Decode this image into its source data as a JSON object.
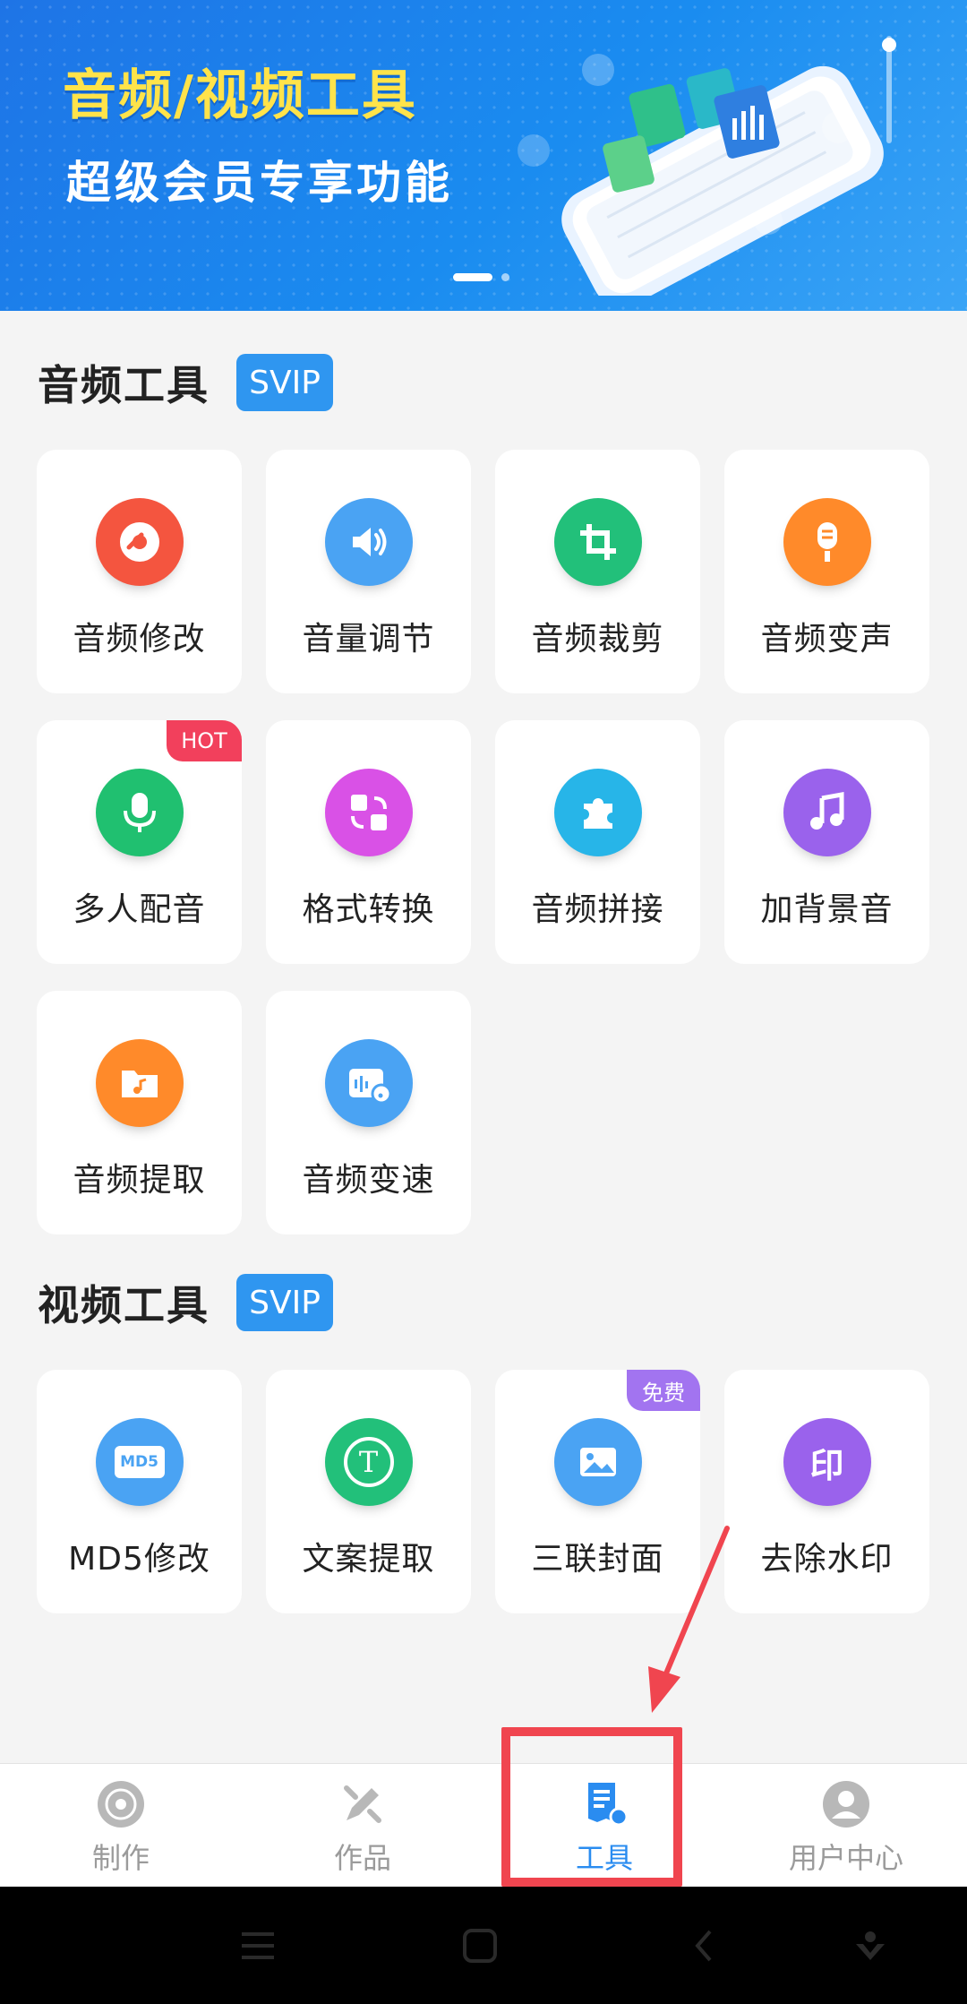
{
  "banner": {
    "title": "音频/视频工具",
    "subtitle": "超级会员专享功能"
  },
  "audio_section": {
    "title": "音频工具",
    "badge": "SVIP",
    "tools": [
      {
        "label": "音频修改",
        "icon": "disc-edit-icon",
        "color": "#f4553f"
      },
      {
        "label": "音量调节",
        "icon": "speaker-icon",
        "color": "#4aa3f3"
      },
      {
        "label": "音频裁剪",
        "icon": "crop-icon",
        "color": "#22c07a"
      },
      {
        "label": "音频变声",
        "icon": "microphone-icon",
        "color": "#ff8a2a"
      },
      {
        "label": "多人配音",
        "icon": "mic-icon",
        "color": "#20c070",
        "badge": "HOT"
      },
      {
        "label": "格式转换",
        "icon": "convert-icon",
        "color": "#d951e6"
      },
      {
        "label": "音频拼接",
        "icon": "puzzle-icon",
        "color": "#27b5e8"
      },
      {
        "label": "加背景音",
        "icon": "music-note-icon",
        "color": "#9a62ec"
      },
      {
        "label": "音频提取",
        "icon": "folder-music-icon",
        "color": "#ff8a2a"
      },
      {
        "label": "音频变速",
        "icon": "audio-speed-icon",
        "color": "#4aa3f3"
      }
    ]
  },
  "video_section": {
    "title": "视频工具",
    "badge": "SVIP",
    "tools": [
      {
        "label": "MD5修改",
        "icon": "md5-icon",
        "icon_text": "MD5",
        "color": "#4aa3f3"
      },
      {
        "label": "文案提取",
        "icon": "text-t-icon",
        "icon_text": "T",
        "color": "#22c07a"
      },
      {
        "label": "三联封面",
        "icon": "image-icon",
        "color": "#4aa3f3",
        "badge": "免费"
      },
      {
        "label": "去除水印",
        "icon": "watermark-icon",
        "icon_text": "印",
        "color": "#9a62ec"
      }
    ]
  },
  "bottom_nav": {
    "items": [
      {
        "label": "制作",
        "icon": "disc-icon"
      },
      {
        "label": "作品",
        "icon": "pen-tool-icon"
      },
      {
        "label": "工具",
        "icon": "document-tool-icon",
        "active": true
      },
      {
        "label": "用户中心",
        "icon": "user-icon"
      }
    ]
  },
  "colors": {
    "accent": "#2a8cf0",
    "annotation": "#f0454f"
  }
}
